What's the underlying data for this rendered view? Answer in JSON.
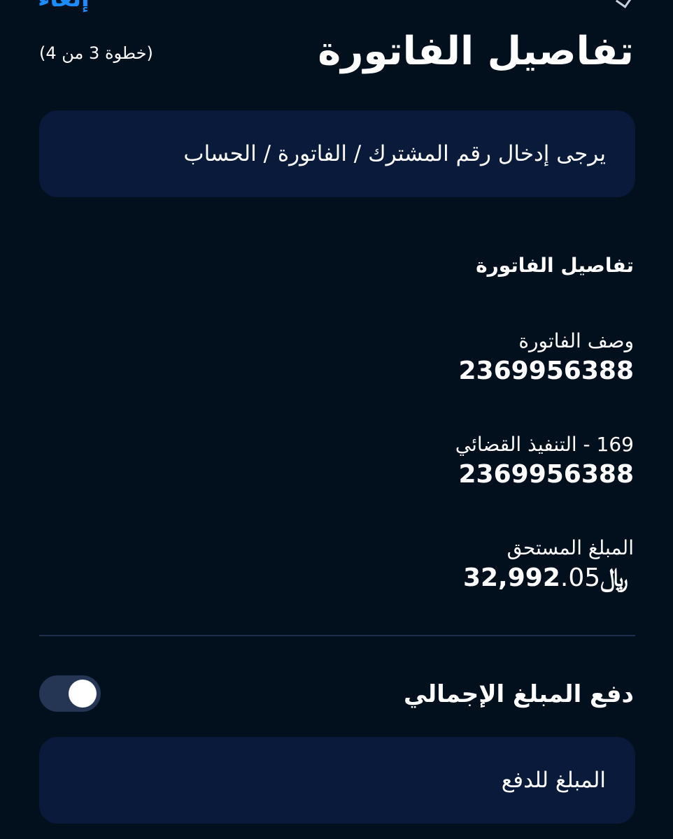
{
  "header": {
    "top_link": "إلغاء",
    "title": "تفاصيل الفاتورة",
    "step": "(خطوة 3 من 4)"
  },
  "subscriber_input": {
    "placeholder": "يرجى إدخال رقم المشترك / الفاتورة / الحساب"
  },
  "bill_details": {
    "heading": "تفاصيل الفاتورة",
    "fields": [
      {
        "label": "وصف الفاتورة",
        "value": "2369956388"
      },
      {
        "label": "169 - التنفيذ القضائي",
        "value": "2369956388"
      }
    ],
    "due": {
      "label": "المبلغ المستحق",
      "integer": "32,992",
      "decimal": ".05",
      "currency": "﷼"
    }
  },
  "pay_full": {
    "label": "دفع المبلغ الإجمالي",
    "enabled": true
  },
  "amount_input": {
    "placeholder": "المبلغ للدفع"
  },
  "colors": {
    "background": "#020f1d",
    "input_bg": "#0a1a3a",
    "accent": "#1a8cff",
    "toggle_track": "#243654"
  }
}
